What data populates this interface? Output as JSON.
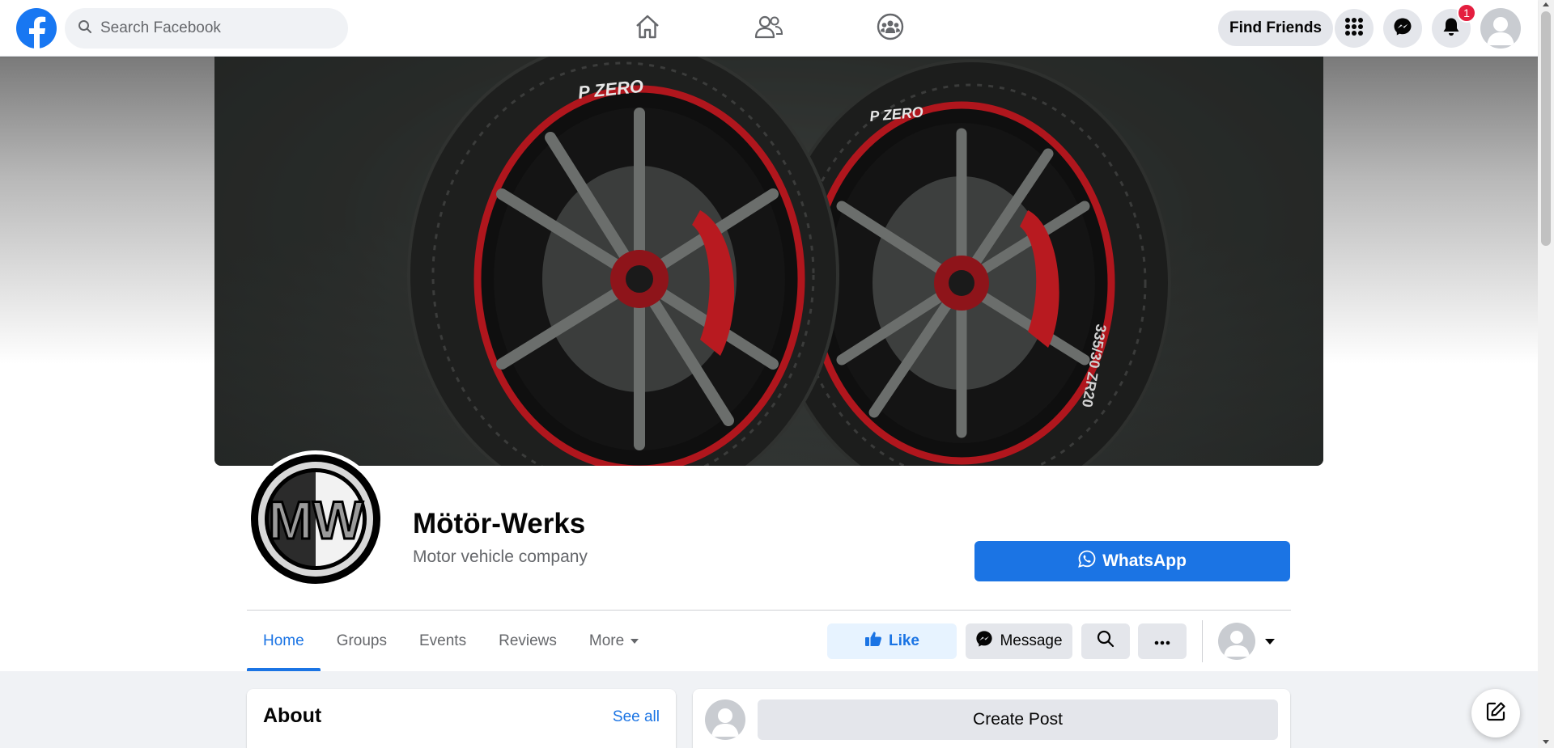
{
  "topbar": {
    "search_placeholder": "Search Facebook",
    "find_friends_label": "Find Friends",
    "notification_count": "1",
    "nav_icons": [
      "home-icon",
      "friends-icon",
      "groups-icon"
    ],
    "right_icons": [
      "menu-grid-icon",
      "messenger-icon",
      "bell-icon"
    ]
  },
  "cover": {
    "tire_label": "P ZERO",
    "tire_size": "335/30 ZR20"
  },
  "page": {
    "name": "Mötör-Werks",
    "category": "Motor vehicle company",
    "logo_text": "MW",
    "whatsapp_label": "WhatsApp"
  },
  "tabs": [
    {
      "label": "Home",
      "active": true
    },
    {
      "label": "Groups"
    },
    {
      "label": "Events"
    },
    {
      "label": "Reviews"
    },
    {
      "label": "More"
    }
  ],
  "actions": {
    "like_label": "Like",
    "message_label": "Message"
  },
  "about": {
    "title": "About",
    "see_all": "See all"
  },
  "post": {
    "create_label": "Create Post"
  },
  "colors": {
    "brand_blue": "#1b74e4",
    "facebook_blue": "#1877f2",
    "badge_red": "#e41e3f",
    "background": "#f0f2f5"
  }
}
